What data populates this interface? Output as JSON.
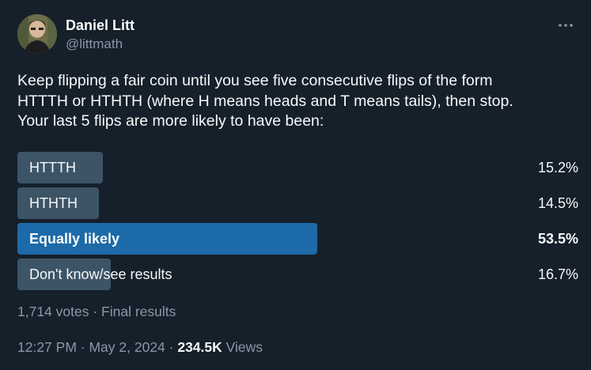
{
  "author": {
    "name": "Daniel Litt",
    "handle": "@littmath"
  },
  "tweet": {
    "text": "Keep flipping a fair coin until you see five consecutive flips of the form\nHTTTH or HTHTH (where H means heads and T means tails), then stop.\nYour last 5 flips are more likely to have been:"
  },
  "poll": {
    "options": [
      {
        "label": "HTTTH",
        "percent_text": "15.2%",
        "percent": 15.2,
        "winner": false
      },
      {
        "label": "HTHTH",
        "percent_text": "14.5%",
        "percent": 14.5,
        "winner": false
      },
      {
        "label": "Equally likely",
        "percent_text": "53.5%",
        "percent": 53.5,
        "winner": true
      },
      {
        "label": "Don't know/see results",
        "percent_text": "16.7%",
        "percent": 16.7,
        "winner": false
      }
    ],
    "votes": "1,714 votes",
    "separator": " · ",
    "status": "Final results"
  },
  "meta": {
    "time": "12:27 PM",
    "separator": " · ",
    "date": "May 2, 2024",
    "views_count": "234.5K",
    "views_label": "Views"
  },
  "colors": {
    "background": "#15202b",
    "bar": "#3d5466",
    "bar_winner": "#1d6aa8",
    "text": "#f7f9f9",
    "secondary_text": "#8b98a5"
  }
}
